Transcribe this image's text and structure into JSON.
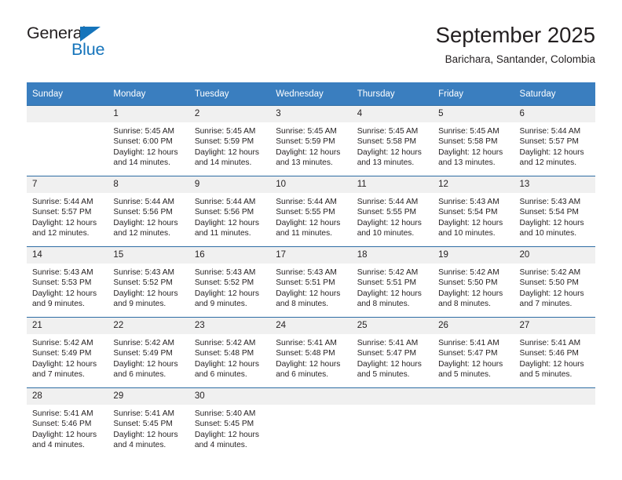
{
  "brand": {
    "name_part1": "General",
    "name_part2": "Blue"
  },
  "header": {
    "title": "September 2025",
    "subtitle": "Barichara, Santander, Colombia"
  },
  "colors": {
    "header_blue": "#3a7ebf",
    "row_border_blue": "#2e6da4",
    "daynum_band": "#f0f0f0",
    "brand_blue": "#1574bb",
    "text": "#231f20"
  },
  "weekday_headers": [
    "Sunday",
    "Monday",
    "Tuesday",
    "Wednesday",
    "Thursday",
    "Friday",
    "Saturday"
  ],
  "weeks": [
    [
      {
        "day": "",
        "lines": []
      },
      {
        "day": "1",
        "lines": [
          "Sunrise: 5:45 AM",
          "Sunset: 6:00 PM",
          "Daylight: 12 hours",
          "and 14 minutes."
        ]
      },
      {
        "day": "2",
        "lines": [
          "Sunrise: 5:45 AM",
          "Sunset: 5:59 PM",
          "Daylight: 12 hours",
          "and 14 minutes."
        ]
      },
      {
        "day": "3",
        "lines": [
          "Sunrise: 5:45 AM",
          "Sunset: 5:59 PM",
          "Daylight: 12 hours",
          "and 13 minutes."
        ]
      },
      {
        "day": "4",
        "lines": [
          "Sunrise: 5:45 AM",
          "Sunset: 5:58 PM",
          "Daylight: 12 hours",
          "and 13 minutes."
        ]
      },
      {
        "day": "5",
        "lines": [
          "Sunrise: 5:45 AM",
          "Sunset: 5:58 PM",
          "Daylight: 12 hours",
          "and 13 minutes."
        ]
      },
      {
        "day": "6",
        "lines": [
          "Sunrise: 5:44 AM",
          "Sunset: 5:57 PM",
          "Daylight: 12 hours",
          "and 12 minutes."
        ]
      }
    ],
    [
      {
        "day": "7",
        "lines": [
          "Sunrise: 5:44 AM",
          "Sunset: 5:57 PM",
          "Daylight: 12 hours",
          "and 12 minutes."
        ]
      },
      {
        "day": "8",
        "lines": [
          "Sunrise: 5:44 AM",
          "Sunset: 5:56 PM",
          "Daylight: 12 hours",
          "and 12 minutes."
        ]
      },
      {
        "day": "9",
        "lines": [
          "Sunrise: 5:44 AM",
          "Sunset: 5:56 PM",
          "Daylight: 12 hours",
          "and 11 minutes."
        ]
      },
      {
        "day": "10",
        "lines": [
          "Sunrise: 5:44 AM",
          "Sunset: 5:55 PM",
          "Daylight: 12 hours",
          "and 11 minutes."
        ]
      },
      {
        "day": "11",
        "lines": [
          "Sunrise: 5:44 AM",
          "Sunset: 5:55 PM",
          "Daylight: 12 hours",
          "and 10 minutes."
        ]
      },
      {
        "day": "12",
        "lines": [
          "Sunrise: 5:43 AM",
          "Sunset: 5:54 PM",
          "Daylight: 12 hours",
          "and 10 minutes."
        ]
      },
      {
        "day": "13",
        "lines": [
          "Sunrise: 5:43 AM",
          "Sunset: 5:54 PM",
          "Daylight: 12 hours",
          "and 10 minutes."
        ]
      }
    ],
    [
      {
        "day": "14",
        "lines": [
          "Sunrise: 5:43 AM",
          "Sunset: 5:53 PM",
          "Daylight: 12 hours",
          "and 9 minutes."
        ]
      },
      {
        "day": "15",
        "lines": [
          "Sunrise: 5:43 AM",
          "Sunset: 5:52 PM",
          "Daylight: 12 hours",
          "and 9 minutes."
        ]
      },
      {
        "day": "16",
        "lines": [
          "Sunrise: 5:43 AM",
          "Sunset: 5:52 PM",
          "Daylight: 12 hours",
          "and 9 minutes."
        ]
      },
      {
        "day": "17",
        "lines": [
          "Sunrise: 5:43 AM",
          "Sunset: 5:51 PM",
          "Daylight: 12 hours",
          "and 8 minutes."
        ]
      },
      {
        "day": "18",
        "lines": [
          "Sunrise: 5:42 AM",
          "Sunset: 5:51 PM",
          "Daylight: 12 hours",
          "and 8 minutes."
        ]
      },
      {
        "day": "19",
        "lines": [
          "Sunrise: 5:42 AM",
          "Sunset: 5:50 PM",
          "Daylight: 12 hours",
          "and 8 minutes."
        ]
      },
      {
        "day": "20",
        "lines": [
          "Sunrise: 5:42 AM",
          "Sunset: 5:50 PM",
          "Daylight: 12 hours",
          "and 7 minutes."
        ]
      }
    ],
    [
      {
        "day": "21",
        "lines": [
          "Sunrise: 5:42 AM",
          "Sunset: 5:49 PM",
          "Daylight: 12 hours",
          "and 7 minutes."
        ]
      },
      {
        "day": "22",
        "lines": [
          "Sunrise: 5:42 AM",
          "Sunset: 5:49 PM",
          "Daylight: 12 hours",
          "and 6 minutes."
        ]
      },
      {
        "day": "23",
        "lines": [
          "Sunrise: 5:42 AM",
          "Sunset: 5:48 PM",
          "Daylight: 12 hours",
          "and 6 minutes."
        ]
      },
      {
        "day": "24",
        "lines": [
          "Sunrise: 5:41 AM",
          "Sunset: 5:48 PM",
          "Daylight: 12 hours",
          "and 6 minutes."
        ]
      },
      {
        "day": "25",
        "lines": [
          "Sunrise: 5:41 AM",
          "Sunset: 5:47 PM",
          "Daylight: 12 hours",
          "and 5 minutes."
        ]
      },
      {
        "day": "26",
        "lines": [
          "Sunrise: 5:41 AM",
          "Sunset: 5:47 PM",
          "Daylight: 12 hours",
          "and 5 minutes."
        ]
      },
      {
        "day": "27",
        "lines": [
          "Sunrise: 5:41 AM",
          "Sunset: 5:46 PM",
          "Daylight: 12 hours",
          "and 5 minutes."
        ]
      }
    ],
    [
      {
        "day": "28",
        "lines": [
          "Sunrise: 5:41 AM",
          "Sunset: 5:46 PM",
          "Daylight: 12 hours",
          "and 4 minutes."
        ]
      },
      {
        "day": "29",
        "lines": [
          "Sunrise: 5:41 AM",
          "Sunset: 5:45 PM",
          "Daylight: 12 hours",
          "and 4 minutes."
        ]
      },
      {
        "day": "30",
        "lines": [
          "Sunrise: 5:40 AM",
          "Sunset: 5:45 PM",
          "Daylight: 12 hours",
          "and 4 minutes."
        ]
      },
      {
        "day": "",
        "lines": []
      },
      {
        "day": "",
        "lines": []
      },
      {
        "day": "",
        "lines": []
      },
      {
        "day": "",
        "lines": []
      }
    ]
  ]
}
